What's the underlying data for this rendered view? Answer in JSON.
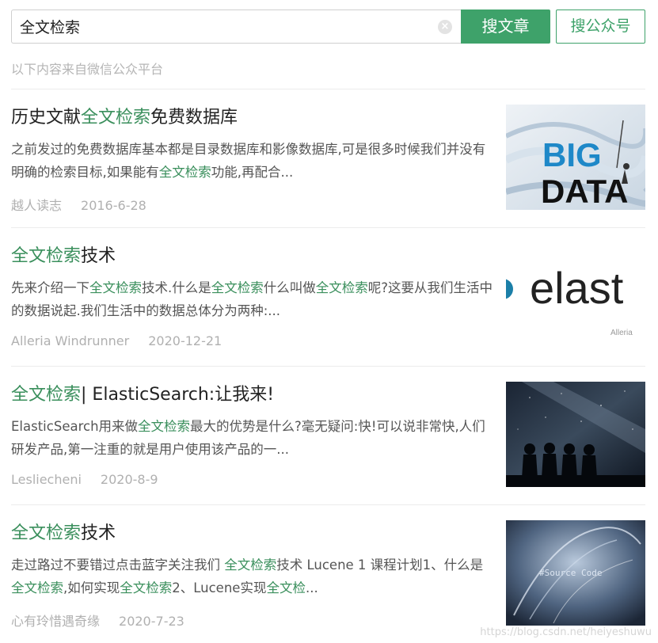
{
  "search": {
    "query": "全文检索",
    "clear_icon": "×",
    "primary_button": "搜文章",
    "secondary_button": "搜公众号"
  },
  "source_note": "以下内容来自微信公众平台",
  "results": [
    {
      "title": {
        "pre": "历史文献",
        "hl": "全文检索",
        "post": "免费数据库"
      },
      "desc": [
        {
          "t": "之前发过的免费数据库基本都是目录数据库和影像数据库,可是很多时候我们并没有明确的检索目标,如果能有",
          "h": false
        },
        {
          "t": "全文检索",
          "h": true
        },
        {
          "t": "功能,再配合...",
          "h": false
        }
      ],
      "author": "越人读志",
      "date": "2016-6-28",
      "thumb_text": [
        "BIG",
        "DATA"
      ]
    },
    {
      "title": {
        "pre": "",
        "hl": "全文检索",
        "post": "技术"
      },
      "desc": [
        {
          "t": "先来介绍一下",
          "h": false
        },
        {
          "t": "全文检索",
          "h": true
        },
        {
          "t": "技术.什么是",
          "h": false
        },
        {
          "t": "全文检索",
          "h": true
        },
        {
          "t": "什么叫做",
          "h": false
        },
        {
          "t": "全文检索",
          "h": true
        },
        {
          "t": "呢?这要从我们生活中的数据说起.我们生活中的数据总体分为两种:...",
          "h": false
        }
      ],
      "author": "Alleria Windrunner",
      "date": "2020-12-21",
      "thumb_text": [
        "elast",
        "Alleria"
      ]
    },
    {
      "title": {
        "pre": "",
        "hl": "全文检索",
        "sep": "|",
        "post": " ElasticSearch:让我来!"
      },
      "desc": [
        {
          "t": "ElasticSearch用来做",
          "h": false
        },
        {
          "t": "全文检索",
          "h": true
        },
        {
          "t": "最大的优势是什么?毫无疑问:快!可以说非常快,人们研发产品,第一注重的就是用户使用该产品的一...",
          "h": false
        }
      ],
      "author": "Lesliecheni",
      "date": "2020-8-9",
      "thumb_text": []
    },
    {
      "title": {
        "pre": "",
        "hl": "全文检索",
        "post": "技术"
      },
      "desc": [
        {
          "t": "走过路过不要错过点击蓝字关注我们 ",
          "h": false
        },
        {
          "t": "全文检索",
          "h": true
        },
        {
          "t": "技术 Lucene 1 课程计划1、什么是",
          "h": false
        },
        {
          "t": "全文检索",
          "h": true
        },
        {
          "t": ",如何实现",
          "h": false
        },
        {
          "t": "全文检索",
          "h": true
        },
        {
          "t": "2、Lucene实现",
          "h": false
        },
        {
          "t": "全文检",
          "h": true
        },
        {
          "t": "...",
          "h": false
        }
      ],
      "author": "心有玲惜遇奇缘",
      "date": "2020-7-23",
      "thumb_text": [
        "#Source Code"
      ]
    }
  ],
  "watermark": "https://blog.csdn.net/heiyeshuwu"
}
